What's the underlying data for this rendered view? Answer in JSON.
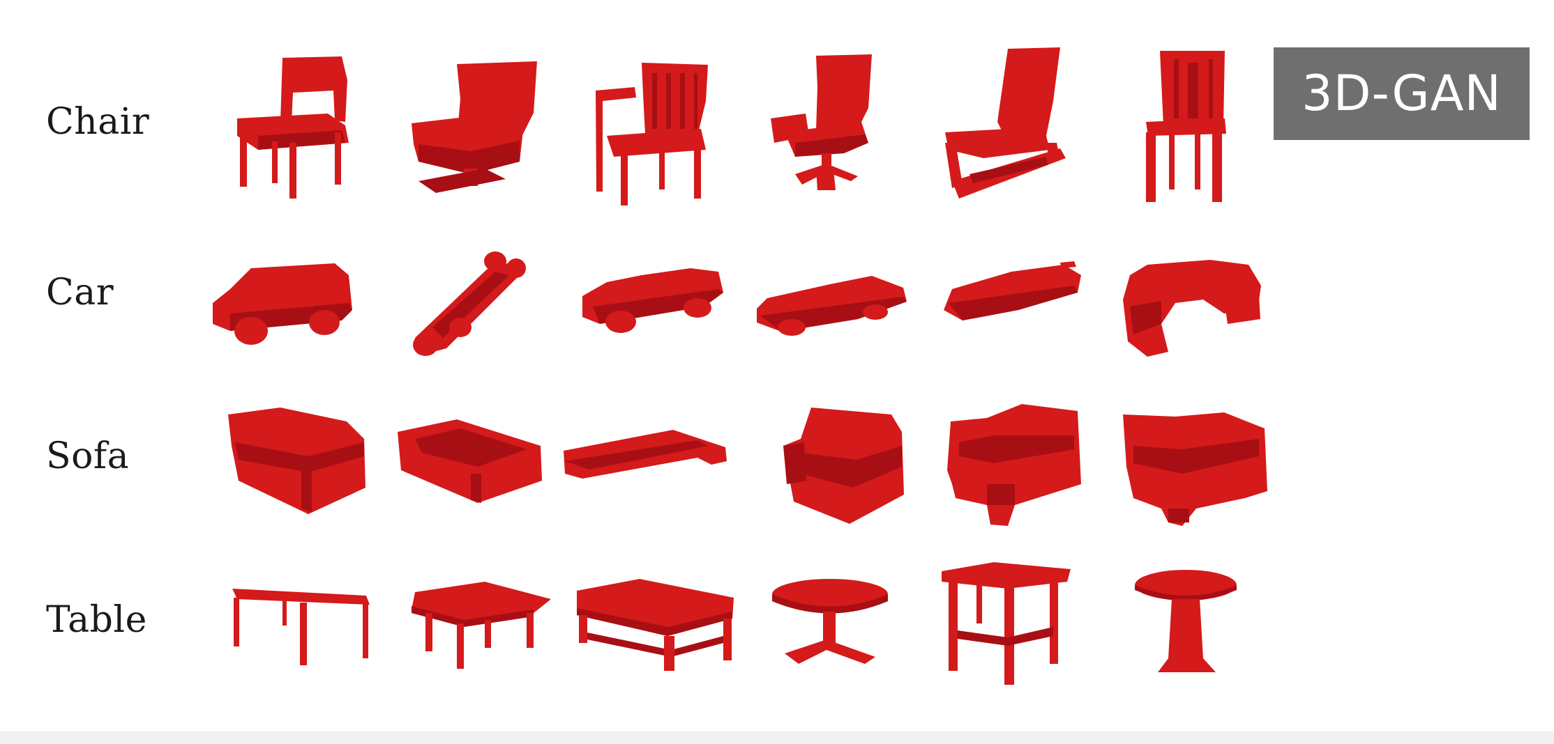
{
  "rows": [
    {
      "label": "Chair"
    },
    {
      "label": "Car"
    },
    {
      "label": "Sofa"
    },
    {
      "label": "Table"
    }
  ],
  "badge": {
    "text": "3D-GAN"
  },
  "colors": {
    "shape_fill": "#d41a1a",
    "shape_shadow": "#a80f14",
    "badge_background": "#6f6f6f",
    "badge_text": "#ffffff"
  }
}
